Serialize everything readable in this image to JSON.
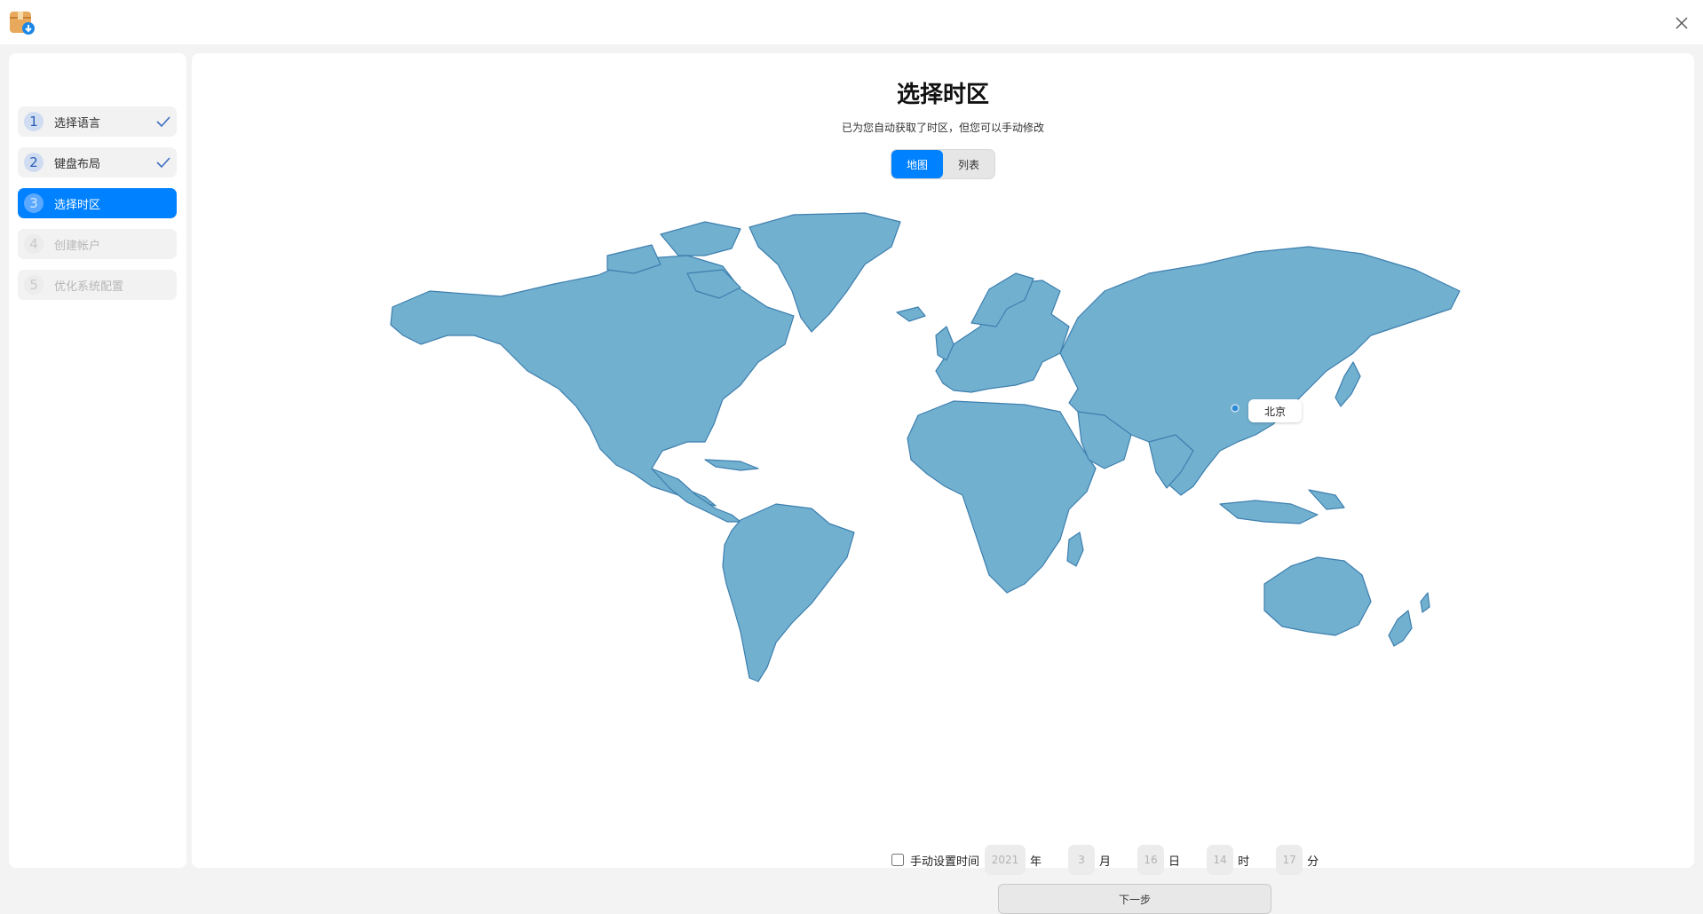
{
  "window": {
    "app_icon": "package-download-icon",
    "close_icon": "close-icon"
  },
  "sidebar": {
    "steps": [
      {
        "num": "1",
        "label": "选择语言",
        "state": "done"
      },
      {
        "num": "2",
        "label": "键盘布局",
        "state": "done"
      },
      {
        "num": "3",
        "label": "选择时区",
        "state": "active"
      },
      {
        "num": "4",
        "label": "创建帐户",
        "state": "disabled"
      },
      {
        "num": "5",
        "label": "优化系统配置",
        "state": "disabled"
      }
    ]
  },
  "main": {
    "title": "选择时区",
    "subtitle": "已为您自动获取了时区，但您可以手动修改",
    "tabs": {
      "map": "地图",
      "list": "列表",
      "selected": "map"
    },
    "map_label": "北京",
    "manual": {
      "checkbox_label": "手动设置时间",
      "checked": false,
      "year": "2021",
      "year_unit": "年",
      "month": "3",
      "month_unit": "月",
      "day": "16",
      "day_unit": "日",
      "hour": "14",
      "hour_unit": "时",
      "minute": "17",
      "minute_unit": "分"
    },
    "next_label": "下一步"
  },
  "colors": {
    "accent": "#0081ff",
    "map_fill": "#72b0d0",
    "map_stroke": "#3d7fae"
  }
}
